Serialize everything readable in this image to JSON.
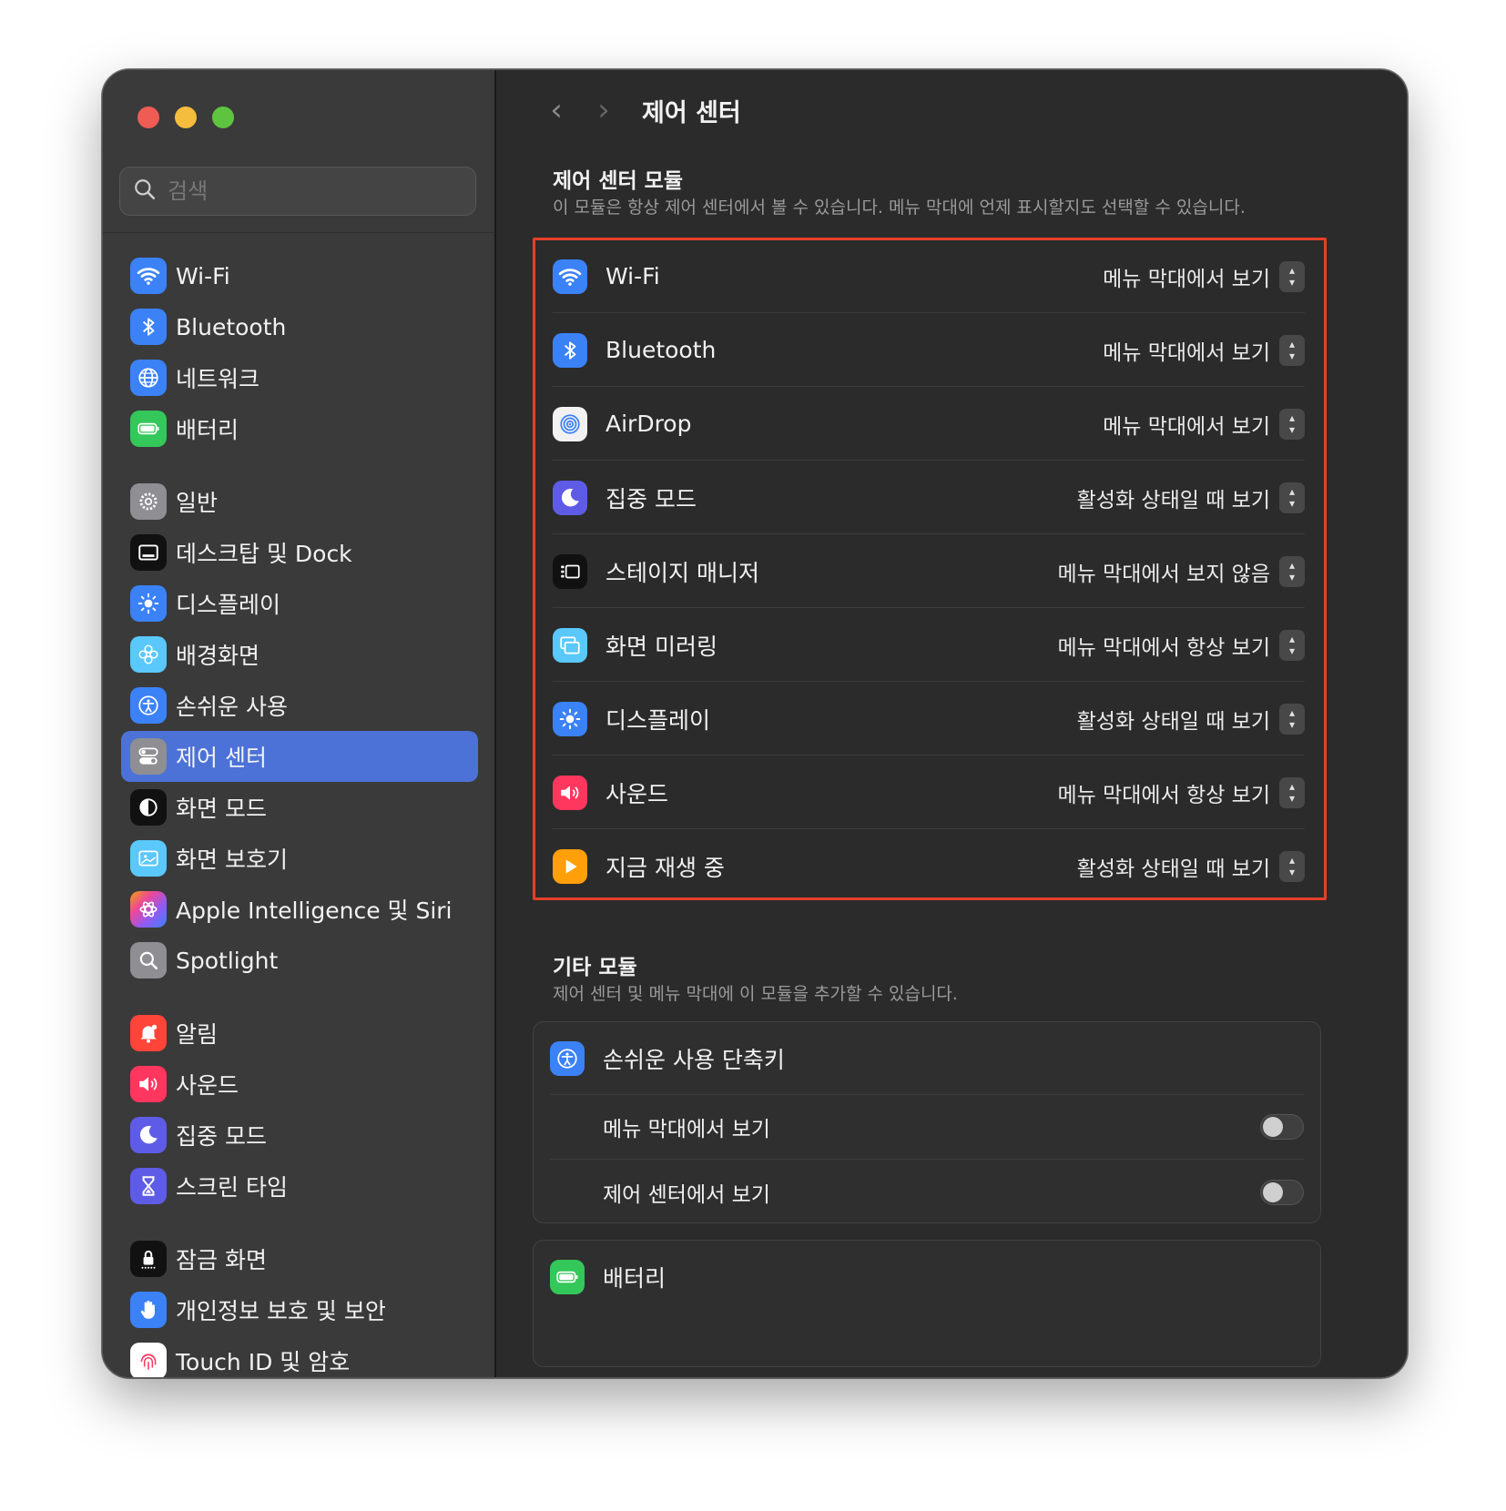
{
  "window": {
    "title": "제어 센터"
  },
  "search": {
    "placeholder": "검색"
  },
  "sidebar": {
    "items": [
      {
        "label": "Wi-Fi"
      },
      {
        "label": "Bluetooth"
      },
      {
        "label": "네트워크"
      },
      {
        "label": "배터리"
      },
      {
        "label": "일반"
      },
      {
        "label": "데스크탑 및 Dock"
      },
      {
        "label": "디스플레이"
      },
      {
        "label": "배경화면"
      },
      {
        "label": "손쉬운 사용"
      },
      {
        "label": "제어 센터"
      },
      {
        "label": "화면 모드"
      },
      {
        "label": "화면 보호기"
      },
      {
        "label": "Apple Intelligence 및 Siri"
      },
      {
        "label": "Spotlight"
      },
      {
        "label": "알림"
      },
      {
        "label": "사운드"
      },
      {
        "label": "집중 모드"
      },
      {
        "label": "스크린 타임"
      },
      {
        "label": "잠금 화면"
      },
      {
        "label": "개인정보 보호 및 보안"
      },
      {
        "label": "Touch ID 및 암호"
      }
    ]
  },
  "main": {
    "title": "제어 센터",
    "control_modules": {
      "title": "제어 센터 모듈",
      "subtitle": "이 모듈은 항상 제어 센터에서 볼 수 있습니다. 메뉴 막대에 언제 표시할지도 선택할 수 있습니다.",
      "rows": [
        {
          "name": "Wi-Fi",
          "value": "메뉴 막대에서 보기"
        },
        {
          "name": "Bluetooth",
          "value": "메뉴 막대에서 보기"
        },
        {
          "name": "AirDrop",
          "value": "메뉴 막대에서 보기"
        },
        {
          "name": "집중 모드",
          "value": "활성화 상태일 때 보기"
        },
        {
          "name": "스테이지 매니저",
          "value": "메뉴 막대에서 보지 않음"
        },
        {
          "name": "화면 미러링",
          "value": "메뉴 막대에서 항상 보기"
        },
        {
          "name": "디스플레이",
          "value": "활성화 상태일 때 보기"
        },
        {
          "name": "사운드",
          "value": "메뉴 막대에서 항상 보기"
        },
        {
          "name": "지금 재생 중",
          "value": "활성화 상태일 때 보기"
        }
      ]
    },
    "other_modules": {
      "title": "기타 모듈",
      "subtitle": "제어 센터 및 메뉴 막대에 이 모듈을 추가할 수 있습니다.",
      "accessibility": {
        "name": "손쉬운 사용 단축키",
        "menu_bar_label": "메뉴 막대에서 보기",
        "menu_bar_on": false,
        "control_center_label": "제어 센터에서 보기",
        "control_center_on": false
      },
      "battery": {
        "name": "배터리"
      }
    }
  },
  "colors": {
    "accent": "#4c72d8",
    "highlight_box": "#e5402a"
  }
}
